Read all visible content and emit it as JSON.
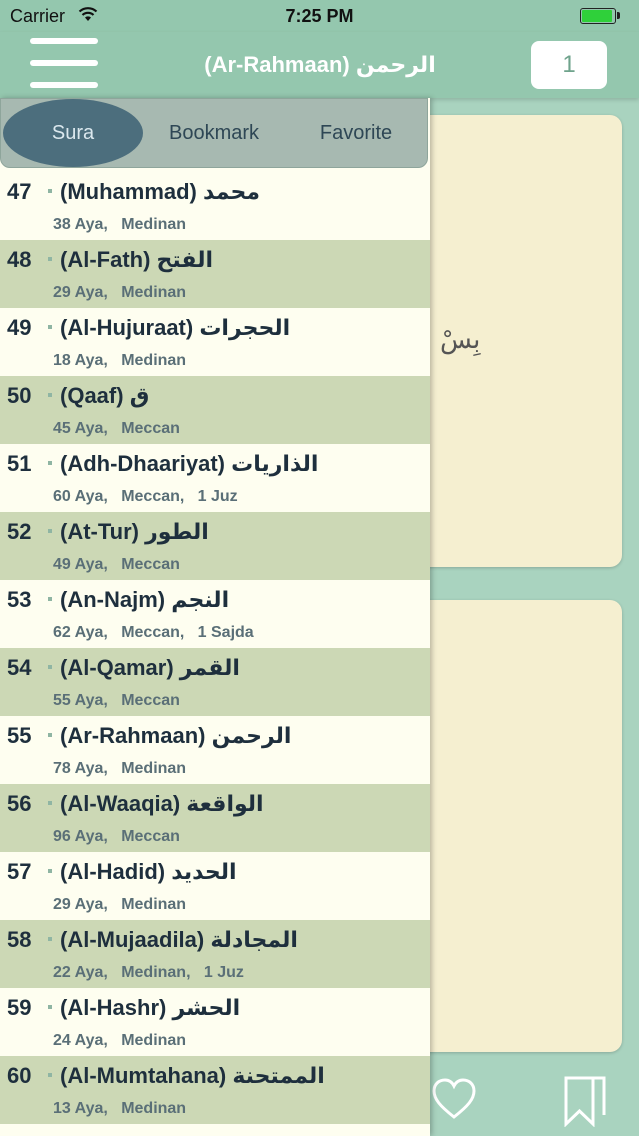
{
  "status_bar": {
    "carrier": "Carrier",
    "time": "7:25 PM",
    "battery_level": 0.95
  },
  "nav": {
    "title": "(Ar-Rahmaan) الرحمن",
    "page_number": "1"
  },
  "segments": {
    "sura": "Sura",
    "bookmark": "Bookmark",
    "favorite": "Favorite"
  },
  "reader": {
    "bismillah": "بِسْ"
  },
  "suras": [
    {
      "number": "47",
      "name": "(Muhammad) محمد",
      "meta": "38 Aya,   Medinan"
    },
    {
      "number": "48",
      "name": "(Al-Fath) الفتح",
      "meta": "29 Aya,   Medinan"
    },
    {
      "number": "49",
      "name": "(Al-Hujuraat) الحجرات",
      "meta": "18 Aya,   Medinan"
    },
    {
      "number": "50",
      "name": "(Qaaf) ق",
      "meta": "45 Aya,   Meccan"
    },
    {
      "number": "51",
      "name": "(Adh-Dhaariyat) الذاريات",
      "meta": "60 Aya,   Meccan,   1 Juz"
    },
    {
      "number": "52",
      "name": "(At-Tur) الطور",
      "meta": "49 Aya,   Meccan"
    },
    {
      "number": "53",
      "name": "(An-Najm) النجم",
      "meta": "62 Aya,   Meccan,   1 Sajda"
    },
    {
      "number": "54",
      "name": "(Al-Qamar) القمر",
      "meta": "55 Aya,   Meccan"
    },
    {
      "number": "55",
      "name": "(Ar-Rahmaan) الرحمن",
      "meta": "78 Aya,   Medinan"
    },
    {
      "number": "56",
      "name": "(Al-Waaqia) الواقعة",
      "meta": "96 Aya,   Meccan"
    },
    {
      "number": "57",
      "name": "(Al-Hadid) الحديد",
      "meta": "29 Aya,   Medinan"
    },
    {
      "number": "58",
      "name": "(Al-Mujaadila) المجادلة",
      "meta": "22 Aya,   Medinan,   1 Juz"
    },
    {
      "number": "59",
      "name": "(Al-Hashr) الحشر",
      "meta": "24 Aya,   Medinan"
    },
    {
      "number": "60",
      "name": "(Al-Mumtahana) الممتحنة",
      "meta": "13 Aya,   Medinan"
    }
  ],
  "icons": {
    "menu": "hamburger-icon",
    "wifi": "wifi-icon",
    "favorite": "heart-icon",
    "bookmark": "bookmark-icon"
  },
  "colors": {
    "accent": "#94c7ae",
    "selected_segment": "#4c6e7d",
    "row_light": "#fefef0",
    "row_dark": "#ccd8b5"
  }
}
